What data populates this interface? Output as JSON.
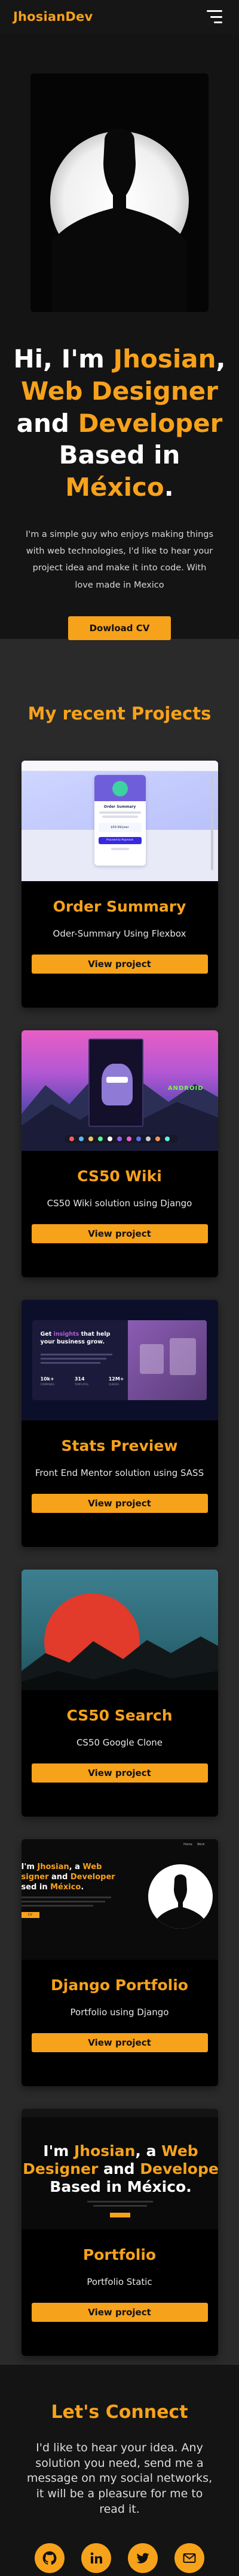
{
  "header": {
    "logo": "JhosianDev",
    "menu_icon": "hamburger-menu-icon"
  },
  "hero": {
    "title": {
      "p1": "Hi, I'm ",
      "name": "Jhosian",
      "p2": ",",
      "role1": "Web Designer",
      "p3": " and ",
      "role2": "Developer",
      "p4": "Based in ",
      "place": "México",
      "p5": "."
    },
    "description": "I'm a simple guy who enjoys making things with web technologies, I'd like to hear your project idea and make it into code. With love made in Mexico",
    "cv_button": "Dowload CV"
  },
  "projects": {
    "title": "My recent Projects",
    "items": [
      {
        "title": "Order Summary",
        "description": "Oder-Summary Using Flexbox",
        "button": "View project",
        "thumb": {
          "heading": "Order Summary",
          "price": "$59.99/year",
          "cta": "Proceed to Payment"
        }
      },
      {
        "title": "CS50 Wiki",
        "description": "CS50 Wiki solution using Django",
        "button": "View project",
        "thumb": {
          "sign": "ANDROID"
        }
      },
      {
        "title": "Stats Preview",
        "description": "Front End Mentor solution using SASS",
        "button": "View project",
        "thumb": {
          "line1": "Get ",
          "hl": "insights",
          "line1b": " that help",
          "line2": "your business grow.",
          "stats": [
            {
              "value": "10k+",
              "label": "COMPANIES"
            },
            {
              "value": "314",
              "label": "TEMPLATES"
            },
            {
              "value": "12M+",
              "label": "QUERIES"
            }
          ]
        }
      },
      {
        "title": "CS50 Search",
        "description": "CS50 Google Clone",
        "button": "View project"
      },
      {
        "title": "Django Portfolio",
        "description": "Portfolio using Django",
        "button": "View project",
        "thumb": {
          "l1a": "I'm ",
          "l1b": "Jhosian",
          "l1c": ", a ",
          "l1d": "Web",
          "l2a": "signer",
          "l2b": " and ",
          "l2c": "Developer",
          "l3a": "sed in ",
          "l3b": "México",
          "l3c": ".",
          "nav1": "Home",
          "nav2": "Work",
          "btn": "CV"
        }
      },
      {
        "title": "Portfolio",
        "description": "Portfolio Static",
        "button": "View project",
        "thumb": {
          "l1a": "I'm ",
          "l1b": "Jhosian",
          "l1c": ", a ",
          "l1d": "Web",
          "l2a": "Designer",
          "l2b": " and ",
          "l2c": "Develope",
          "l3": "Based in México."
        }
      }
    ]
  },
  "connect": {
    "title": "Let's Connect",
    "description": "I'd like to hear your idea. Any solution you need, send me a message on my social networks, it will be a pleasure for me to read it.",
    "socials": [
      {
        "name": "github",
        "icon": "github-icon"
      },
      {
        "name": "linkedin",
        "icon": "linkedin-icon"
      },
      {
        "name": "twitter",
        "icon": "twitter-icon"
      },
      {
        "name": "email",
        "icon": "mail-icon"
      }
    ]
  },
  "colors": {
    "accent": "#f7a21b",
    "background": "#2a2a2a",
    "hero_background": "#141414",
    "card": "#000000"
  }
}
